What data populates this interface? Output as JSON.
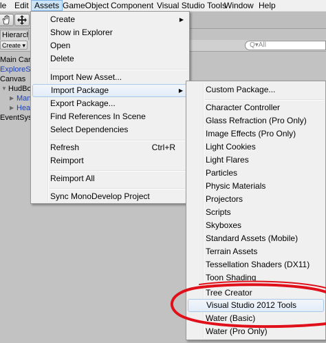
{
  "menubar": {
    "items": [
      {
        "label": "le"
      },
      {
        "label": "Edit"
      },
      {
        "label": "Assets"
      },
      {
        "label": "GameObject"
      },
      {
        "label": "Component"
      },
      {
        "label": "Visual Studio Tools"
      },
      {
        "label": "Window"
      },
      {
        "label": "Help"
      }
    ]
  },
  "hierarchy": {
    "tab_label": "Hierarch",
    "create_label": "Create ▾",
    "search_placeholder": "Q▾All",
    "items": [
      {
        "label": "Main Car"
      },
      {
        "label": "ExploreS"
      },
      {
        "label": "Canvas"
      },
      {
        "label": "HudBo"
      },
      {
        "label": "Man"
      },
      {
        "label": "Hea"
      },
      {
        "label": "EventSys"
      }
    ]
  },
  "assets_menu": {
    "items": [
      {
        "label": "Create"
      },
      {
        "label": "Show in Explorer"
      },
      {
        "label": "Open"
      },
      {
        "label": "Delete"
      },
      {
        "label": "Import New Asset..."
      },
      {
        "label": "Import Package"
      },
      {
        "label": "Export Package..."
      },
      {
        "label": "Find References In Scene"
      },
      {
        "label": "Select Dependencies"
      },
      {
        "label": "Refresh",
        "shortcut": "Ctrl+R"
      },
      {
        "label": "Reimport"
      },
      {
        "label": "Reimport All"
      },
      {
        "label": "Sync MonoDevelop Project"
      }
    ],
    "submenu_arrow": "▶"
  },
  "import_package_menu": {
    "items": [
      {
        "label": "Custom Package..."
      },
      {
        "label": "Character Controller"
      },
      {
        "label": "Glass Refraction (Pro Only)"
      },
      {
        "label": "Image Effects (Pro Only)"
      },
      {
        "label": "Light Cookies"
      },
      {
        "label": "Light Flares"
      },
      {
        "label": "Particles"
      },
      {
        "label": "Physic Materials"
      },
      {
        "label": "Projectors"
      },
      {
        "label": "Scripts"
      },
      {
        "label": "Skyboxes"
      },
      {
        "label": "Standard Assets (Mobile)"
      },
      {
        "label": "Terrain Assets"
      },
      {
        "label": "Tessellation Shaders (DX11)"
      },
      {
        "label": "Toon Shading"
      },
      {
        "label": "Tree Creator"
      },
      {
        "label": "Visual Studio 2012 Tools"
      },
      {
        "label": "Water (Basic)"
      },
      {
        "label": "Water (Pro Only)"
      }
    ]
  },
  "colors": {
    "highlight_border": "#a8c8ea",
    "annotation": "#e0101a",
    "link_blue": "#1c3fb2"
  }
}
